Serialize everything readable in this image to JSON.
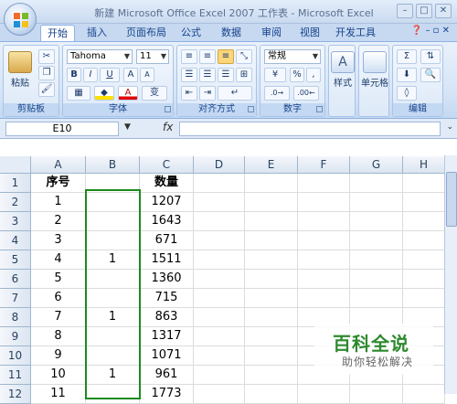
{
  "window": {
    "title": "新建 Microsoft Office Excel 2007 工作表 - Microsoft Excel"
  },
  "tabs": [
    "开始",
    "插入",
    "页面布局",
    "公式",
    "数据",
    "审阅",
    "视图",
    "开发工具"
  ],
  "ribbon": {
    "clipboard": {
      "label": "剪贴板",
      "paste": "粘贴"
    },
    "font": {
      "label": "字体",
      "name": "Tahoma",
      "size": "11",
      "bold": "B",
      "italic": "I",
      "underline": "U",
      "grow": "A",
      "shrink": "A",
      "wen": "变"
    },
    "alignment": {
      "label": "对齐方式"
    },
    "number": {
      "label": "数字",
      "format": "常规",
      "percent": "%",
      "comma": ","
    },
    "styles": {
      "label": "样式"
    },
    "cells": {
      "label": "单元格"
    },
    "editing": {
      "label": "编辑"
    }
  },
  "formula_bar": {
    "name_box": "E10",
    "fx": "fx",
    "value": ""
  },
  "sheet": {
    "columns": [
      "A",
      "B",
      "C",
      "D",
      "E",
      "F",
      "G",
      "H"
    ],
    "rows": [
      {
        "n": "1",
        "a": "序号",
        "b": "",
        "c": "数量"
      },
      {
        "n": "2",
        "a": "1",
        "b": "",
        "c": "1207"
      },
      {
        "n": "3",
        "a": "2",
        "b": "",
        "c": "1643"
      },
      {
        "n": "4",
        "a": "3",
        "b": "",
        "c": "671"
      },
      {
        "n": "5",
        "a": "4",
        "b": "1",
        "c": "1511"
      },
      {
        "n": "6",
        "a": "5",
        "b": "",
        "c": "1360"
      },
      {
        "n": "7",
        "a": "6",
        "b": "",
        "c": "715"
      },
      {
        "n": "8",
        "a": "7",
        "b": "1",
        "c": "863"
      },
      {
        "n": "9",
        "a": "8",
        "b": "",
        "c": "1317"
      },
      {
        "n": "10",
        "a": "9",
        "b": "",
        "c": "1071"
      },
      {
        "n": "11",
        "a": "10",
        "b": "1",
        "c": "961"
      },
      {
        "n": "12",
        "a": "11",
        "b": "",
        "c": "1773"
      }
    ]
  },
  "watermark": {
    "title": "百科全说",
    "subtitle": "助你轻松解决"
  },
  "colors": {
    "accent": "#15428b",
    "ribbon": "#d5e4f6",
    "selection_border": "#1c8a1c"
  }
}
